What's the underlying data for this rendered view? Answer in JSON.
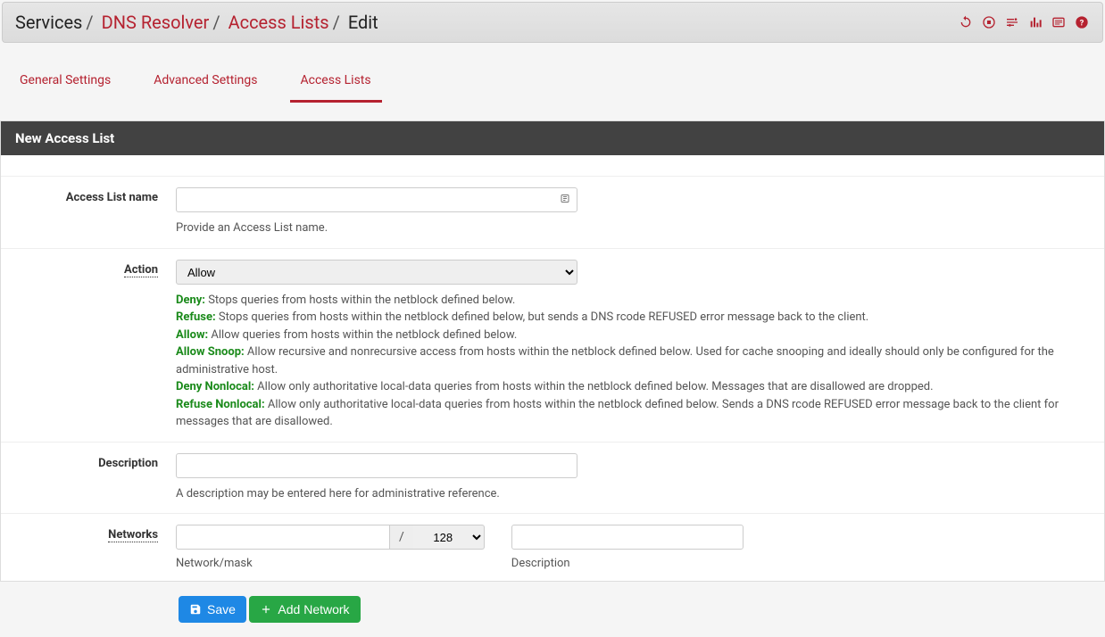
{
  "breadcrumb": {
    "services": "Services",
    "dns_resolver": "DNS Resolver",
    "access_lists": "Access Lists",
    "current": "Edit"
  },
  "tabs": {
    "general": "General Settings",
    "advanced": "Advanced Settings",
    "acl": "Access Lists"
  },
  "panel": {
    "title": "New Access List"
  },
  "form": {
    "name_label": "Access List name",
    "name_value": "",
    "name_help": "Provide an Access List name.",
    "action_label": "Action",
    "action_value": "Allow",
    "action_help": {
      "deny_k": "Deny:",
      "deny_t": " Stops queries from hosts within the netblock defined below.",
      "refuse_k": "Refuse:",
      "refuse_t": " Stops queries from hosts within the netblock defined below, but sends a DNS rcode REFUSED error message back to the client.",
      "allow_k": "Allow:",
      "allow_t": " Allow queries from hosts within the netblock defined below.",
      "snoop_k": "Allow Snoop:",
      "snoop_t": " Allow recursive and nonrecursive access from hosts within the netblock defined below. Used for cache snooping and ideally should only be configured for the administrative host.",
      "denynl_k": "Deny Nonlocal:",
      "denynl_t": " Allow only authoritative local-data queries from hosts within the netblock defined below. Messages that are disallowed are dropped.",
      "refusenl_k": "Refuse Nonlocal:",
      "refusenl_t": " Allow only authoritative local-data queries from hosts within the netblock defined below. Sends a DNS rcode REFUSED error message back to the client for messages that are disallowed."
    },
    "desc_label": "Description",
    "desc_value": "",
    "desc_help": "A description may be entered here for administrative reference.",
    "networks_label": "Networks",
    "network_value": "",
    "network_mask": "128",
    "network_desc_value": "",
    "network_sublabel": "Network/mask",
    "network_desc_sublabel": "Description",
    "slash": "/"
  },
  "buttons": {
    "save": "Save",
    "add_network": "Add Network"
  }
}
